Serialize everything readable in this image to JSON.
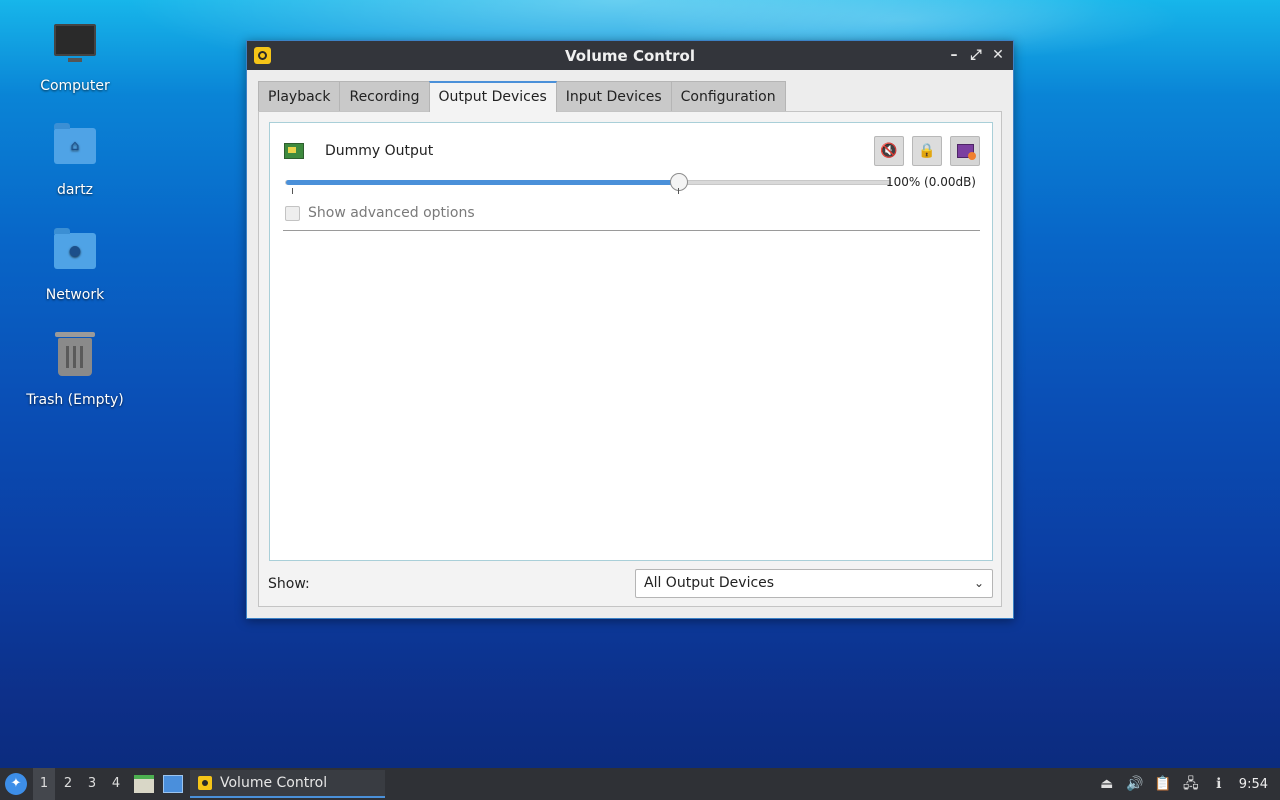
{
  "desktop": {
    "icons": [
      {
        "label": "Computer",
        "icon": "computer-icon"
      },
      {
        "label": "dartz",
        "icon": "home-folder-icon"
      },
      {
        "label": "Network",
        "icon": "network-folder-icon"
      },
      {
        "label": "Trash (Empty)",
        "icon": "trash-icon"
      }
    ]
  },
  "window": {
    "title": "Volume Control",
    "controls": {
      "minimize": "–",
      "maximize": "⤢",
      "close": "✕"
    },
    "tabs": [
      {
        "label": "Playback",
        "active": false
      },
      {
        "label": "Recording",
        "active": false
      },
      {
        "label": "Output Devices",
        "active": true
      },
      {
        "label": "Input Devices",
        "active": false
      },
      {
        "label": "Configuration",
        "active": false
      }
    ],
    "device": {
      "name": "Dummy Output",
      "volume_label": "100% (0.00dB)",
      "volume_fraction": 0.65,
      "advanced_label": "Show advanced options",
      "advanced_checked": false
    },
    "show": {
      "label": "Show:",
      "selected": "All Output Devices"
    }
  },
  "taskbar": {
    "workspaces": [
      "1",
      "2",
      "3",
      "4"
    ],
    "active_workspace": "1",
    "task_label": "Volume Control",
    "clock": "9:54"
  },
  "colors": {
    "accent": "#4a90d9",
    "titlebar": "#33353b",
    "taskbar": "#2f3136"
  }
}
